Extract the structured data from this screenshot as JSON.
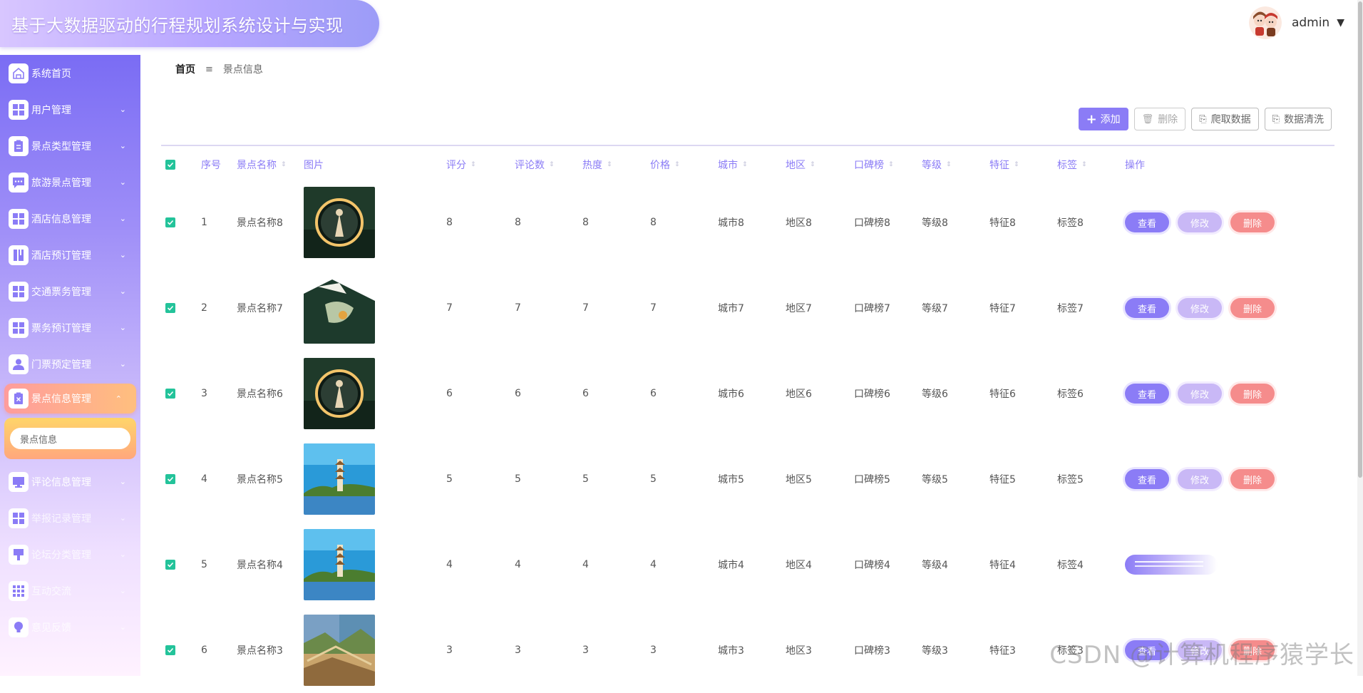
{
  "header": {
    "app_title": "基于大数据驱动的行程规划系统设计与实现",
    "username": "admin",
    "caret": "▼"
  },
  "sidebar": {
    "items": [
      {
        "label": "系统首页",
        "icon": "home-icon",
        "chevron": ""
      },
      {
        "label": "用户管理",
        "icon": "grid-icon",
        "chevron": "⌄"
      },
      {
        "label": "景点类型管理",
        "icon": "clipboard-icon",
        "chevron": "⌄"
      },
      {
        "label": "旅游景点管理",
        "icon": "chat-icon",
        "chevron": "⌄"
      },
      {
        "label": "酒店信息管理",
        "icon": "grid-icon",
        "chevron": "⌄"
      },
      {
        "label": "酒店预订管理",
        "icon": "book-icon",
        "chevron": "⌄"
      },
      {
        "label": "交通票务管理",
        "icon": "grid-icon",
        "chevron": "⌄"
      },
      {
        "label": "票务预订管理",
        "icon": "grid-icon",
        "chevron": "⌄"
      },
      {
        "label": "门票预定管理",
        "icon": "user-icon",
        "chevron": "⌄"
      },
      {
        "label": "景点信息管理",
        "icon": "clipboard-x-icon",
        "chevron": "⌃",
        "active": true
      },
      {
        "label": "评论信息管理",
        "icon": "monitor-icon",
        "chevron": "⌄"
      },
      {
        "label": "举报记录管理",
        "icon": "grid-icon",
        "chevron": "⌄"
      },
      {
        "label": "论坛分类管理",
        "icon": "brush-icon",
        "chevron": "⌄"
      },
      {
        "label": "互动交流",
        "icon": "apps-icon",
        "chevron": "⌄"
      },
      {
        "label": "意见反馈",
        "icon": "bulb-icon",
        "chevron": "⌄"
      }
    ],
    "submenu_label": "景点信息"
  },
  "breadcrumb": {
    "home": "首页",
    "separator": "≡",
    "current": "景点信息"
  },
  "toolbar": {
    "add": "添加",
    "add_icon": "+",
    "delete": "删除",
    "delete_icon": "🗑",
    "crawl": "爬取数据",
    "crawl_icon": "⎘",
    "clean": "数据清洗",
    "clean_icon": "⎘"
  },
  "table": {
    "columns": [
      "序号",
      "景点名称",
      "图片",
      "评分",
      "评论数",
      "热度",
      "价格",
      "城市",
      "地区",
      "口碑榜",
      "等级",
      "特征",
      "标签",
      "操作"
    ],
    "sort_glyph": "⇕",
    "rows": [
      {
        "idx": "1",
        "name": "景点名称8",
        "score": "8",
        "comments": "8",
        "heat": "8",
        "price": "8",
        "city": "城市8",
        "area": "地区8",
        "rank": "口碑榜8",
        "level": "等级8",
        "feature": "特征8",
        "tag": "标签8",
        "image": "moon-portal"
      },
      {
        "idx": "2",
        "name": "景点名称7",
        "score": "7",
        "comments": "7",
        "heat": "7",
        "price": "7",
        "city": "城市7",
        "area": "地区7",
        "rank": "口碑榜7",
        "level": "等级7",
        "feature": "特征7",
        "tag": "标签7",
        "image": "painting"
      },
      {
        "idx": "3",
        "name": "景点名称6",
        "score": "6",
        "comments": "6",
        "heat": "6",
        "price": "6",
        "city": "城市6",
        "area": "地区6",
        "rank": "口碑榜6",
        "level": "等级6",
        "feature": "特征6",
        "tag": "标签6",
        "image": "moon-portal"
      },
      {
        "idx": "4",
        "name": "景点名称5",
        "score": "5",
        "comments": "5",
        "heat": "5",
        "price": "5",
        "city": "城市5",
        "area": "地区5",
        "rank": "口碑榜5",
        "level": "等级5",
        "feature": "特征5",
        "tag": "标签5",
        "image": "pagoda"
      },
      {
        "idx": "5",
        "name": "景点名称4",
        "score": "4",
        "comments": "4",
        "heat": "4",
        "price": "4",
        "city": "城市4",
        "area": "地区4",
        "rank": "口碑榜4",
        "level": "等级4",
        "feature": "特征4",
        "tag": "标签4",
        "image": "pagoda"
      },
      {
        "idx": "6",
        "name": "景点名称3",
        "score": "3",
        "comments": "3",
        "heat": "3",
        "price": "3",
        "city": "城市3",
        "area": "地区3",
        "rank": "口碑榜3",
        "level": "等级3",
        "feature": "特征3",
        "tag": "标签3",
        "image": "great-wall"
      }
    ],
    "actions": {
      "view": "查看",
      "edit": "修改",
      "delete": "删除"
    }
  },
  "watermark": "CSDN @计算机程序猿学长",
  "colors": {
    "primary": "#8b7cf6",
    "danger": "#f58c8c",
    "check": "#23c39a",
    "active_menu": "#ffb080"
  }
}
